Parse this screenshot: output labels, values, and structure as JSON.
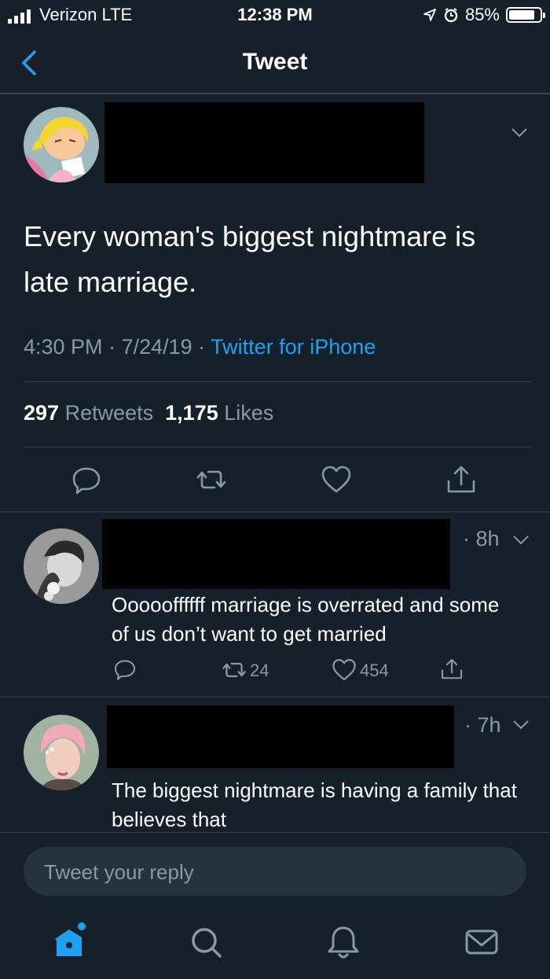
{
  "status_bar": {
    "carrier": "Verizon  LTE",
    "time": "12:38 PM",
    "battery": "85%",
    "battery_level": 0.85
  },
  "nav": {
    "title": "Tweet"
  },
  "tweet": {
    "text": "Every woman's biggest nightmare is late marriage.",
    "time": "4:30 PM",
    "sep1": " · ",
    "date": "7/24/19",
    "sep2": " · ",
    "source": "Twitter for iPhone",
    "retweet_count": "297",
    "retweet_label": " Retweets",
    "like_count": "1,175",
    "like_label": " Likes"
  },
  "replies": [
    {
      "time": "· 8h",
      "text": "Oooooffffff marriage is overrated and some of us don’t want to get married",
      "retweets": "24",
      "likes": "454"
    },
    {
      "time": "· 7h",
      "text": "The biggest nightmare is having a family that believes that"
    }
  ],
  "compose": {
    "placeholder": "Tweet your reply"
  },
  "colors": {
    "background": "#15202b",
    "accent": "#1da1f2",
    "muted": "#8899a6",
    "divider": "#38444d"
  }
}
